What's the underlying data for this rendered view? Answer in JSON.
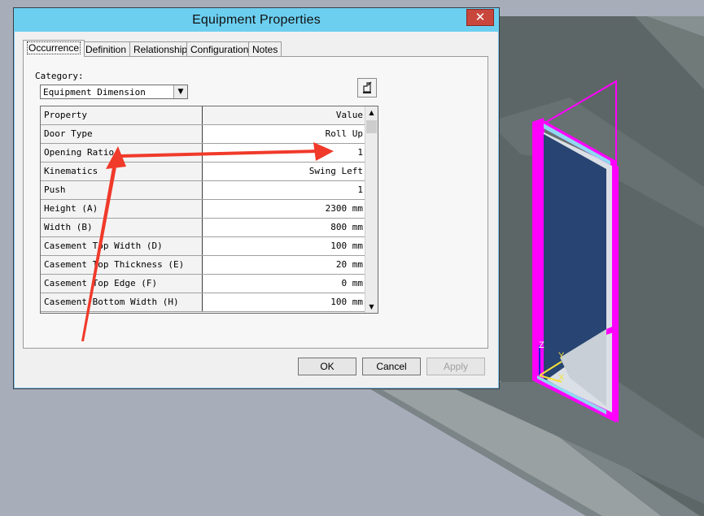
{
  "dialog": {
    "title": "Equipment Properties",
    "close_glyph": "✕",
    "tabs": [
      {
        "label": "Occurrence",
        "active": true
      },
      {
        "label": "Definition"
      },
      {
        "label": "Relationship"
      },
      {
        "label": "Configuration"
      },
      {
        "label": "Notes"
      }
    ],
    "category": {
      "label": "Category:",
      "value": "Equipment Dimension",
      "dropdown_icon": "chevron-down-icon"
    },
    "tool_icon": "edit-properties-icon",
    "grid": {
      "header": {
        "property": "Property",
        "value": "Value"
      },
      "rows": [
        {
          "property": "Door Type",
          "value": "Roll Up"
        },
        {
          "property": "Opening Ratio",
          "value": "1"
        },
        {
          "property": "Kinematics",
          "value": "Swing Left"
        },
        {
          "property": "Push",
          "value": "1"
        },
        {
          "property": "Height (A)",
          "value": "2300 mm"
        },
        {
          "property": "Width (B)",
          "value": "800 mm"
        },
        {
          "property": "Casement Top Width (D)",
          "value": "100 mm"
        },
        {
          "property": "Casement Top Thickness (E)",
          "value": "20 mm"
        },
        {
          "property": "Casement Top Edge (F)",
          "value": "0 mm"
        },
        {
          "property": "Casement Bottom Width (H)",
          "value": "100 mm"
        }
      ],
      "scroll_up_icon": "▲",
      "scroll_down_icon": "▼"
    },
    "buttons": {
      "ok": "OK",
      "cancel": "Cancel",
      "apply": "Apply"
    }
  },
  "viewport": {
    "axis_labels": {
      "z": "Z",
      "y": "Y",
      "x": "X"
    },
    "highlight_color": "#ff00ff",
    "door_panel_color": "#274472"
  },
  "colors": {
    "titlebar": "#6ccff0",
    "close_button": "#c9463d",
    "annotation_arrow": "#f03a2a"
  }
}
